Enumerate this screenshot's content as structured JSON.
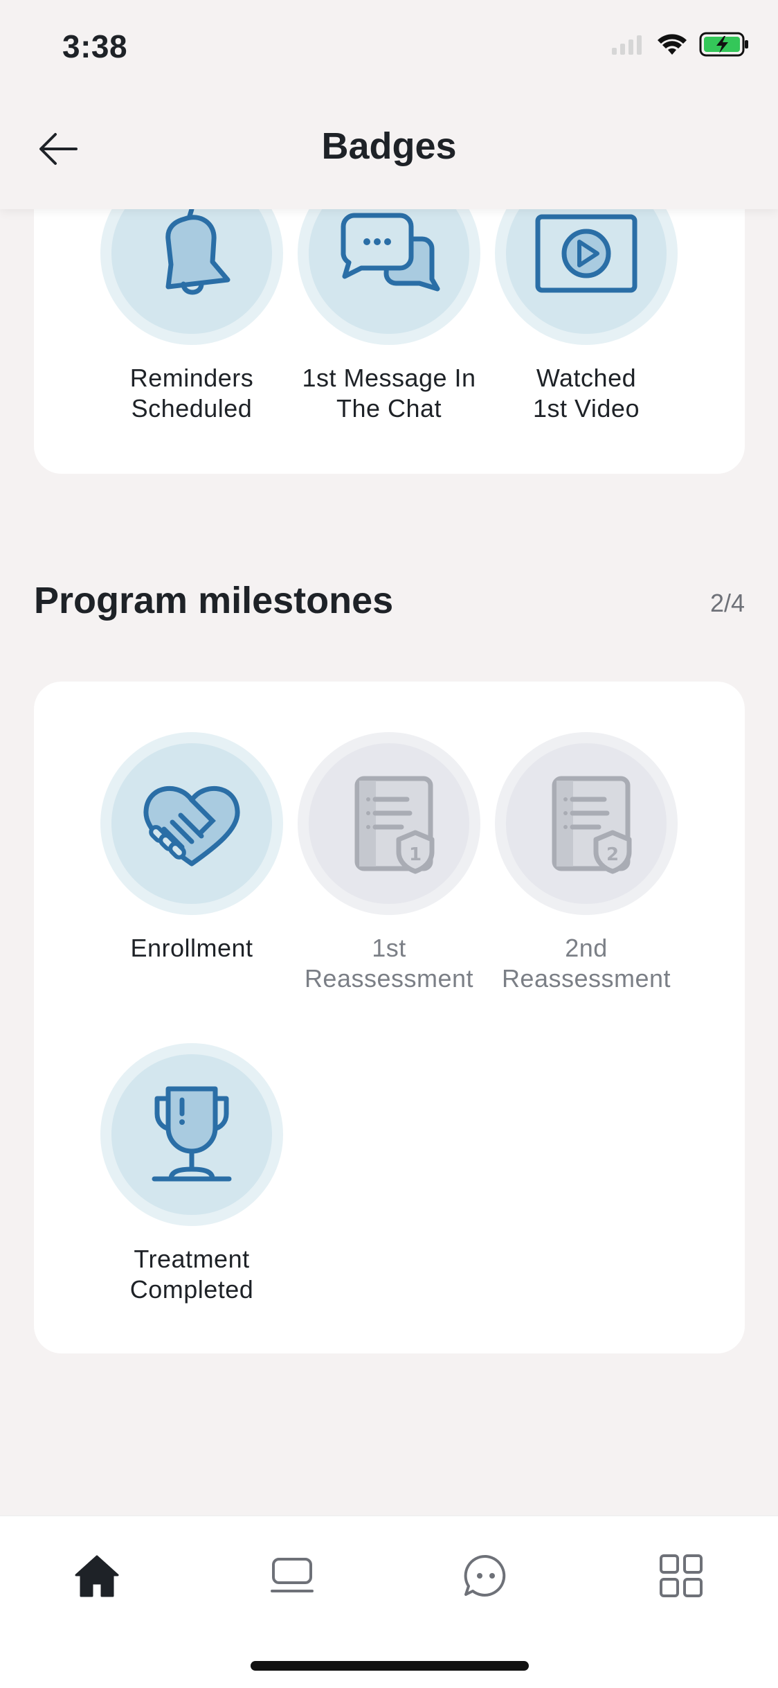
{
  "status_bar": {
    "time": "3:38"
  },
  "header": {
    "title": "Badges"
  },
  "top_badges": [
    {
      "label_line1": "Reminders",
      "label_line2": "Scheduled",
      "icon": "bell-icon"
    },
    {
      "label_line1": "1st Message In",
      "label_line2": "The Chat",
      "icon": "chat-bubbles-icon"
    },
    {
      "label_line1": "Watched",
      "label_line2": "1st Video",
      "icon": "video-play-icon"
    }
  ],
  "milestones": {
    "title": "Program milestones",
    "count": "2/4",
    "items": [
      {
        "label_line1": "Enrollment",
        "label_line2": "",
        "icon": "handshake-heart-icon",
        "earned": true
      },
      {
        "label_line1": "1st",
        "label_line2": "Reassessment",
        "icon": "document-shield-1-icon",
        "earned": false
      },
      {
        "label_line1": "2nd",
        "label_line2": "Reassessment",
        "icon": "document-shield-2-icon",
        "earned": false
      },
      {
        "label_line1": "Treatment",
        "label_line2": "Completed",
        "icon": "trophy-icon",
        "earned": true
      }
    ]
  },
  "bottom_nav": [
    {
      "name": "home",
      "icon": "home-icon",
      "active": true
    },
    {
      "name": "sessions",
      "icon": "laptop-icon",
      "active": false
    },
    {
      "name": "chat",
      "icon": "chat-icon",
      "active": false
    },
    {
      "name": "more",
      "icon": "grid-icon",
      "active": false
    }
  ],
  "colors": {
    "accent": "#2a6ea6",
    "badge_bg": "#d3e6ee",
    "locked_bg": "#e6e7ed",
    "page_bg": "#f5f2f2"
  }
}
